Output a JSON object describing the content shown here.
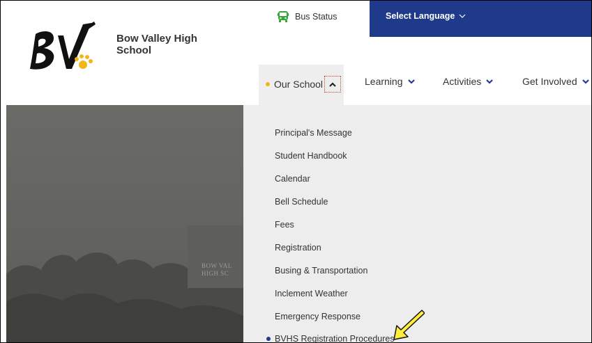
{
  "header": {
    "school_name_line1": "Bow Valley High",
    "school_name_line2": "School",
    "logo_text": "BV"
  },
  "topbar": {
    "bus_status_label": "Bus Status",
    "language_label": "Select Language"
  },
  "nav": {
    "items": [
      {
        "label": "Our School",
        "active": true
      },
      {
        "label": "Learning"
      },
      {
        "label": "Activities"
      },
      {
        "label": "Get Involved"
      }
    ]
  },
  "dropdown": {
    "items": [
      "Principal's Message",
      "Student Handbook",
      "Calendar",
      "Bell Schedule",
      "Fees",
      "Registration",
      "Busing & Transportation",
      "Inclement Weather",
      "Emergency Response",
      "BVHS Registration Procedures"
    ]
  },
  "hero": {
    "sign_line1": "BOW VAL",
    "sign_line2": "HIGH SC"
  },
  "colors": {
    "brand_blue": "#1f3a8a",
    "accent_yellow": "#f2b619",
    "annotation_red": "#c0392b"
  }
}
